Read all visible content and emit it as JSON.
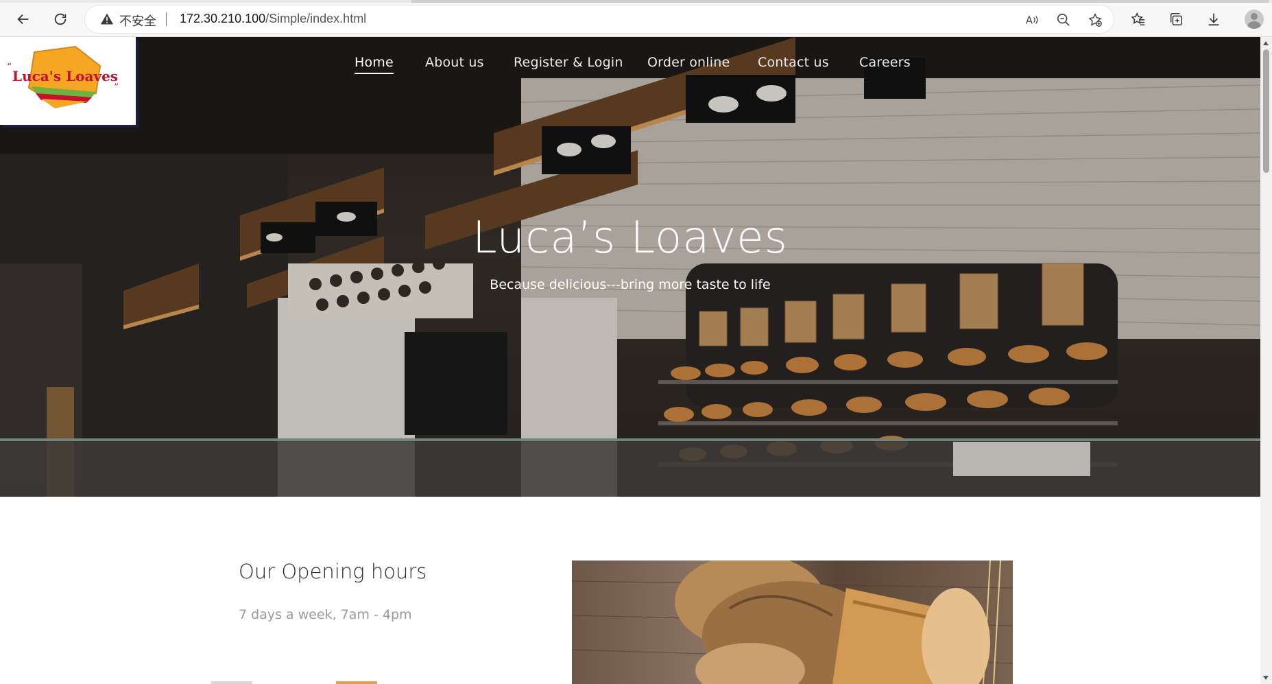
{
  "browser": {
    "security_label": "不安全",
    "url_host": "172.30.210.100",
    "url_path": "/Simple/index.html",
    "icons": [
      "back-arrow-icon",
      "refresh-icon",
      "warning-icon",
      "read-aloud-icon",
      "zoom-out-icon",
      "add-favorite-icon",
      "favorites-icon",
      "collections-icon",
      "download-icon",
      "profile-avatar-icon"
    ]
  },
  "site": {
    "logo_text": "Luca's Loaves",
    "nav": [
      {
        "label": "Home",
        "active": true
      },
      {
        "label": "About us",
        "active": false
      },
      {
        "label": "Register & Login",
        "active": false
      },
      {
        "label": "Order online",
        "active": false
      },
      {
        "label": "Contact us",
        "active": false
      },
      {
        "label": "Careers",
        "active": false
      }
    ],
    "hero": {
      "title": "Luca’s Loaves",
      "subtitle": "Because delicious---bring more taste to life"
    },
    "opening": {
      "heading": "Our Opening hours",
      "text": "7 days a week, 7am - 4pm"
    }
  },
  "colors": {
    "accent": "#e8a04a",
    "logo_orange": "#f5a623",
    "logo_red": "#c8102e",
    "nav_text": "#ececec"
  }
}
